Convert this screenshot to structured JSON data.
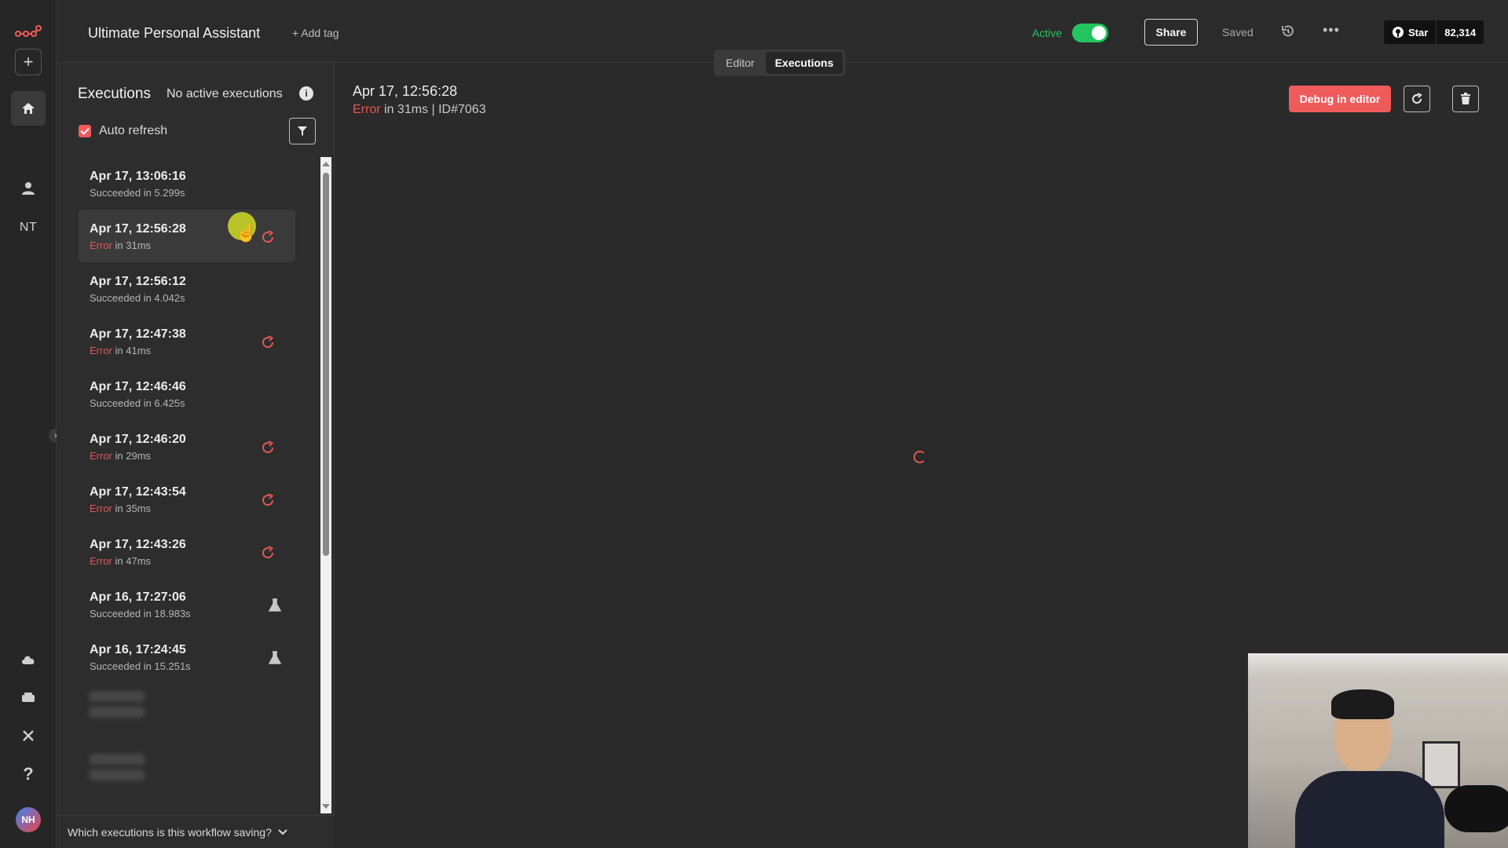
{
  "header": {
    "workflow_name": "Ultimate Personal Assistant",
    "add_tag": "+ Add tag",
    "active_label": "Active",
    "active_on": true,
    "share_label": "Share",
    "saved_label": "Saved",
    "github_star_label": "Star",
    "github_star_count": "82,314",
    "tabs": [
      {
        "label": "Editor",
        "active": false
      },
      {
        "label": "Executions",
        "active": true
      }
    ]
  },
  "rail": {
    "user_initials": "NT",
    "avatar_initials": "NH",
    "icons": [
      "n8n-logo-icon",
      "add-icon",
      "home-icon",
      "person-icon",
      "cloud-icon",
      "templates-icon",
      "variables-icon",
      "help-icon",
      "expand-icon"
    ]
  },
  "executions_panel": {
    "title": "Executions",
    "subtitle": "No active executions",
    "auto_refresh_label": "Auto refresh",
    "auto_refresh_checked": true,
    "items": [
      {
        "timestamp": "Apr 17, 13:06:16",
        "status": "Succeeded",
        "detail": "in 5.299s",
        "action": "none",
        "selected": false
      },
      {
        "timestamp": "Apr 17, 12:56:28",
        "status": "Error",
        "detail": "in 31ms",
        "action": "retry",
        "selected": true
      },
      {
        "timestamp": "Apr 17, 12:56:12",
        "status": "Succeeded",
        "detail": "in 4.042s",
        "action": "none",
        "selected": false
      },
      {
        "timestamp": "Apr 17, 12:47:38",
        "status": "Error",
        "detail": "in 41ms",
        "action": "retry",
        "selected": false
      },
      {
        "timestamp": "Apr 17, 12:46:46",
        "status": "Succeeded",
        "detail": "in 6.425s",
        "action": "none",
        "selected": false
      },
      {
        "timestamp": "Apr 17, 12:46:20",
        "status": "Error",
        "detail": "in 29ms",
        "action": "retry",
        "selected": false
      },
      {
        "timestamp": "Apr 17, 12:43:54",
        "status": "Error",
        "detail": "in 35ms",
        "action": "retry",
        "selected": false
      },
      {
        "timestamp": "Apr 17, 12:43:26",
        "status": "Error",
        "detail": "in 47ms",
        "action": "retry",
        "selected": false
      },
      {
        "timestamp": "Apr 16, 17:27:06",
        "status": "Succeeded",
        "detail": "in 18.983s",
        "action": "test",
        "selected": false
      },
      {
        "timestamp": "Apr 16, 17:24:45",
        "status": "Succeeded",
        "detail": "in 15.251s",
        "action": "test",
        "selected": false
      }
    ],
    "footer_question": "Which executions is this workflow saving?"
  },
  "execution_detail": {
    "date": "Apr 17, 12:56:28",
    "status": "Error",
    "duration": "in 31ms",
    "separator": "|",
    "execution_id": "ID#7063",
    "debug_button": "Debug in editor"
  },
  "colors": {
    "accent_red": "#ef5b5b",
    "active_green": "#22c55e",
    "error_text": "#e05757"
  }
}
